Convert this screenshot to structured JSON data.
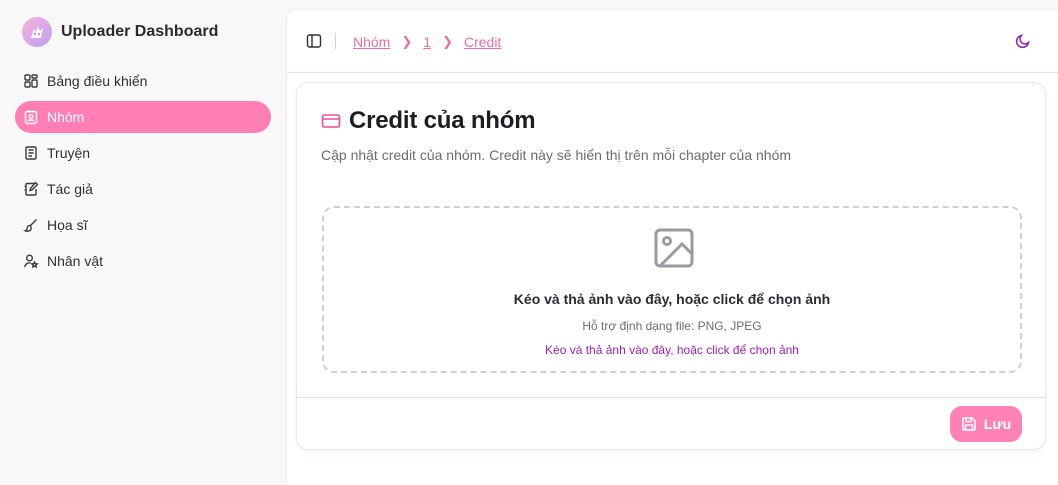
{
  "app": {
    "title": "Uploader Dashboard",
    "logo_icon": "cat-logo-icon"
  },
  "sidebar": {
    "items": [
      {
        "label": "Bảng điều khiển",
        "icon": "dashboard-icon",
        "active": false
      },
      {
        "label": "Nhóm",
        "icon": "group-badge-icon",
        "active": true
      },
      {
        "label": "Truyện",
        "icon": "book-icon",
        "active": false
      },
      {
        "label": "Tác giả",
        "icon": "notebook-pen-icon",
        "active": false
      },
      {
        "label": "Họa sĩ",
        "icon": "brush-icon",
        "active": false
      },
      {
        "label": "Nhân vật",
        "icon": "user-star-icon",
        "active": false
      }
    ]
  },
  "header": {
    "breadcrumb": [
      "Nhóm",
      "1",
      "Credit"
    ],
    "toggle_icon": "sidebar-toggle-icon",
    "theme_icon": "moon-icon"
  },
  "card": {
    "icon": "credit-card-icon",
    "title": "Credit của nhóm",
    "subtitle": "Cập nhật credit của nhóm. Credit này sẽ hiển thị trên mỗi chapter của nhóm"
  },
  "dropzone": {
    "icon": "image-icon",
    "title": "Kéo và thả ảnh vào đây, hoặc click để chọn ảnh",
    "hint": "Hỗ trợ định dạng file: PNG, JPEG",
    "link": "Kéo và thả ảnh vào đây, hoặc click để chọn ảnh"
  },
  "actions": {
    "save_label": "Lưu",
    "save_icon": "save-icon"
  },
  "colors": {
    "accent": "#ff7eb3",
    "link": "#ec6ea2",
    "purple": "#9b1fb3"
  }
}
